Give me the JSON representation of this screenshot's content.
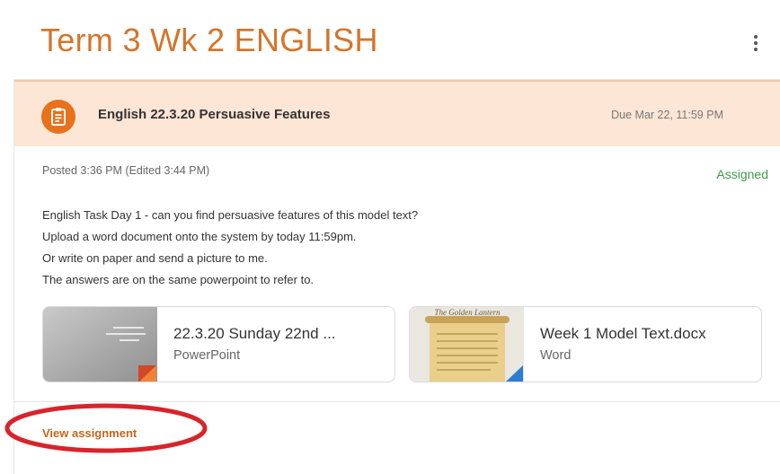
{
  "page": {
    "title": "Term 3 Wk 2 ENGLISH"
  },
  "assignment": {
    "title": "English 22.3.20 Persuasive Features",
    "due": "Due Mar 22, 11:59 PM",
    "posted": "Posted 3:36 PM (Edited 3:44 PM)",
    "status": "Assigned",
    "instructions": [
      "English Task Day 1 - can you find persuasive features of this model text?",
      "Upload a word document onto the system by today 11:59pm.",
      "Or write on paper and send a picture to me.",
      "The answers are on the same powerpoint to refer to."
    ],
    "attachments": [
      {
        "title": "22.3.20 Sunday 22nd ...",
        "type": "PowerPoint",
        "icon": "powerpoint-icon"
      },
      {
        "title": "Week 1 Model Text.docx",
        "type": "Word",
        "icon": "word-icon",
        "thumb_text": "The Golden Lantern"
      }
    ],
    "view_link": "View assignment"
  },
  "colors": {
    "title": "#d4752a",
    "header_bg": "#fde6d6",
    "icon_bg": "#e8711c",
    "status": "#3e9a47",
    "link": "#c2661f",
    "highlight": "#d9232a"
  }
}
